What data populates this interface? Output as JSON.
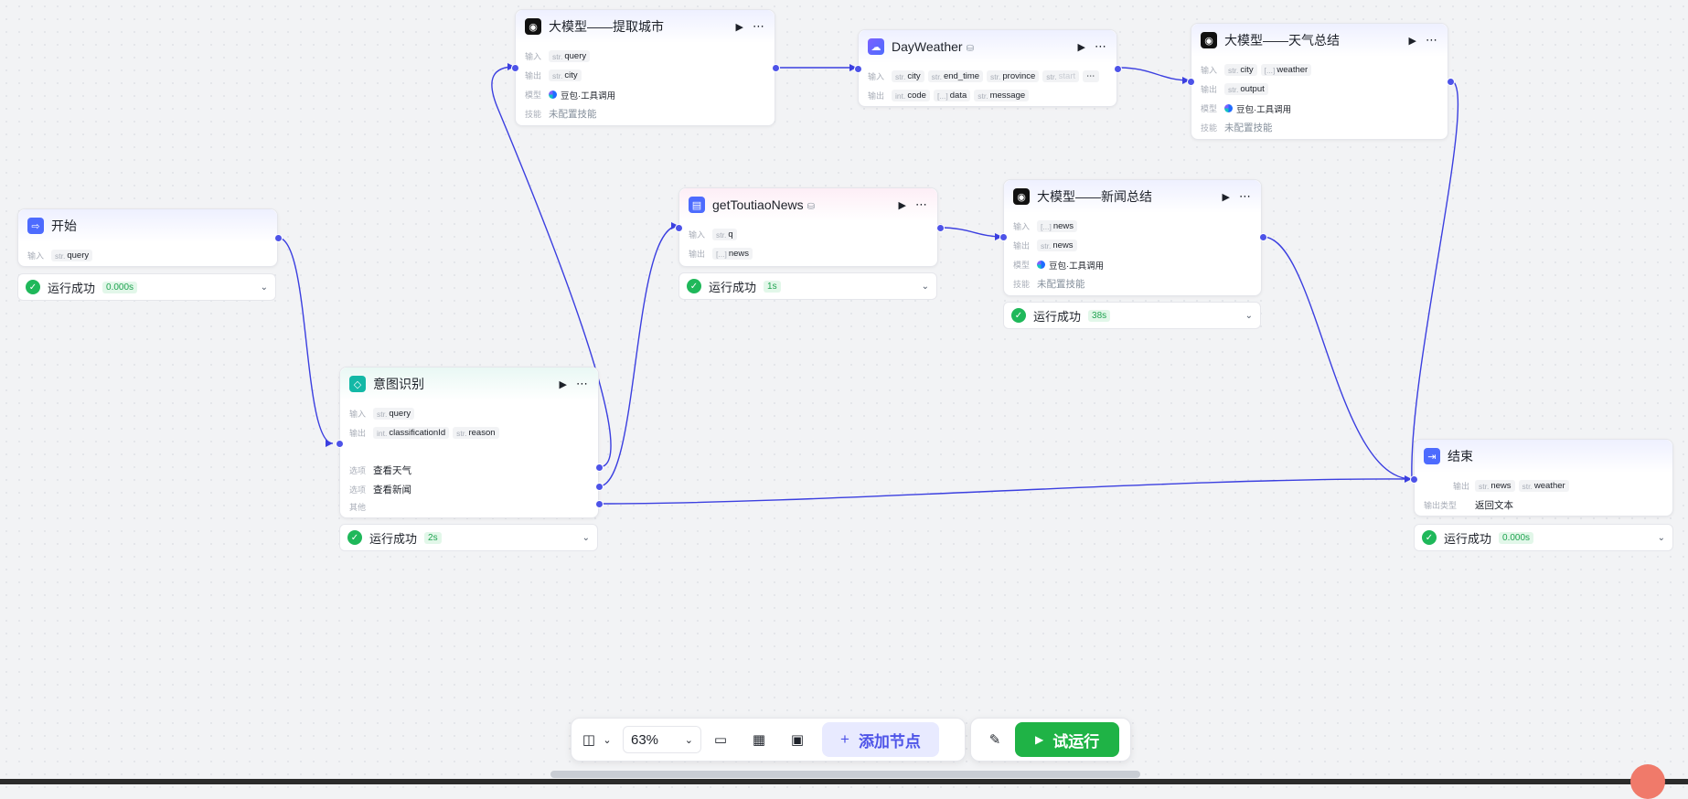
{
  "canvas": {
    "zoom_value": "63%",
    "add_node_label": "添加节点",
    "test_run_label": "试运行"
  },
  "nodes": {
    "start": {
      "title": "开始",
      "input_label": "输入",
      "input": {
        "type": "str.",
        "name": "query"
      }
    },
    "start_status": {
      "text": "运行成功",
      "time": "0.000s"
    },
    "intent": {
      "title": "意图识别",
      "input_label": "输入",
      "input": {
        "type": "str.",
        "name": "query"
      },
      "output_label": "输出",
      "outputs": [
        {
          "type": "int.",
          "name": "classificationId"
        },
        {
          "type": "str.",
          "name": "reason"
        }
      ],
      "option_label": "选项",
      "option1": "查看天气",
      "option2": "查看新闻",
      "other_label": "其他"
    },
    "intent_status": {
      "text": "运行成功",
      "time": "2s"
    },
    "llm_city": {
      "title": "大模型——提取城市",
      "input_label": "输入",
      "input": {
        "type": "str.",
        "name": "query"
      },
      "output_label": "输出",
      "output": {
        "type": "str.",
        "name": "city"
      },
      "model_label": "模型",
      "model": "豆包·工具调用",
      "skill_label": "技能",
      "skill": "未配置技能"
    },
    "weather": {
      "title": "DayWeather",
      "input_label": "输入",
      "inputs": [
        {
          "type": "str.",
          "name": "city"
        },
        {
          "type": "str.",
          "name": "end_time"
        },
        {
          "type": "str.",
          "name": "province"
        },
        {
          "type": "str.",
          "name": "start"
        }
      ],
      "output_label": "输出",
      "outputs": [
        {
          "type": "int.",
          "name": "code"
        },
        {
          "type": "[...]",
          "name": "data"
        },
        {
          "type": "str.",
          "name": "message"
        }
      ]
    },
    "llm_weather": {
      "title": "大模型——天气总结",
      "input_label": "输入",
      "inputs": [
        {
          "type": "str.",
          "name": "city"
        },
        {
          "type": "[...]",
          "name": "weather"
        }
      ],
      "output_label": "输出",
      "output": {
        "type": "str.",
        "name": "output"
      },
      "model_label": "模型",
      "model": "豆包·工具调用",
      "skill_label": "技能",
      "skill": "未配置技能"
    },
    "news": {
      "title": "getToutiaoNews",
      "input_label": "输入",
      "input": {
        "type": "str.",
        "name": "q"
      },
      "output_label": "输出",
      "output": {
        "type": "[...]",
        "name": "news"
      }
    },
    "news_status": {
      "text": "运行成功",
      "time": "1s"
    },
    "llm_news": {
      "title": "大模型——新闻总结",
      "input_label": "输入",
      "input": {
        "type": "[...]",
        "name": "news"
      },
      "output_label": "输出",
      "output": {
        "type": "str.",
        "name": "news"
      },
      "model_label": "模型",
      "model": "豆包·工具调用",
      "skill_label": "技能",
      "skill": "未配置技能"
    },
    "llm_news_status": {
      "text": "运行成功",
      "time": "38s"
    },
    "end": {
      "title": "结束",
      "output_label": "输出",
      "outputs": [
        {
          "type": "str.",
          "name": "news"
        },
        {
          "type": "str.",
          "name": "weather"
        }
      ],
      "output_type_label": "输出类型",
      "output_type": "返回文本"
    },
    "end_status": {
      "text": "运行成功",
      "time": "0.000s"
    }
  },
  "colors": {
    "wire": "#3b3fe0",
    "port": "#4d53e8",
    "success": "#1fb85a",
    "run_button": "#1fb346",
    "add_button_bg": "#e8eaff"
  }
}
